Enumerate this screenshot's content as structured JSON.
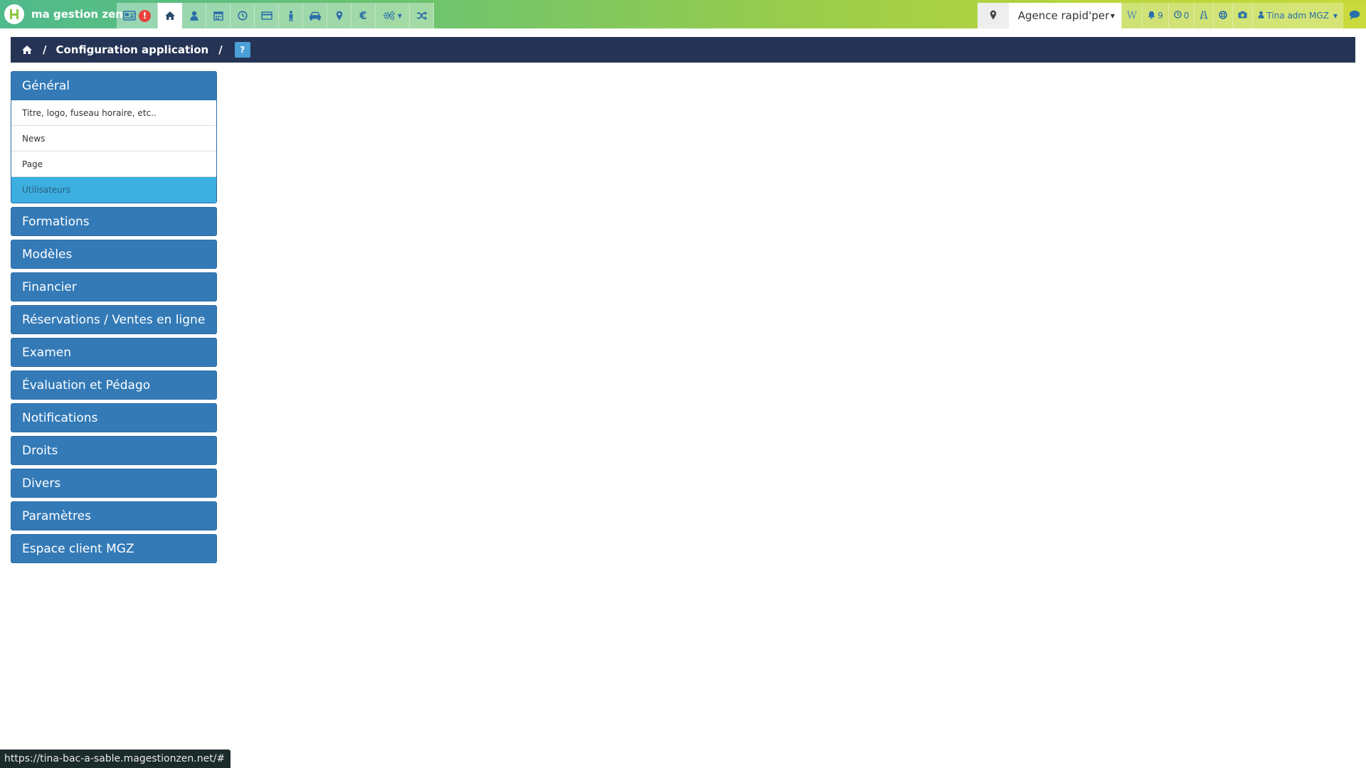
{
  "app": {
    "brand_name": "ma gestion zen"
  },
  "topnav": {
    "alert_badge": "!",
    "items": [
      "news-icon",
      "home-icon",
      "user-icon",
      "calendar-icon",
      "clock-icon",
      "credit-card-icon",
      "person-icon",
      "car-icon",
      "map-marker-icon",
      "euro-icon",
      "settings-icon",
      "shuffle-icon"
    ]
  },
  "rightnav": {
    "agency_select": "Agence rapid'permis",
    "wiki_label": "W",
    "notifications_count": "9",
    "pending_count": "0",
    "user_name": "Tina adm MGZ"
  },
  "breadcrumb": {
    "current": "Configuration application",
    "help": "?"
  },
  "sidemenu": {
    "groups": [
      {
        "label": "Général",
        "items": [
          "Titre, logo, fuseau horaire, etc..",
          "News",
          "Page",
          "Utilisateurs"
        ]
      },
      {
        "label": "Formations"
      },
      {
        "label": "Modèles"
      },
      {
        "label": "Financier"
      },
      {
        "label": "Réservations / Ventes en ligne"
      },
      {
        "label": "Examen"
      },
      {
        "label": "Évaluation et Pédago"
      },
      {
        "label": "Notifications"
      },
      {
        "label": "Droits"
      },
      {
        "label": "Divers"
      },
      {
        "label": "Paramètres"
      },
      {
        "label": "Espace client MGZ"
      }
    ],
    "active_item": "Utilisateurs"
  },
  "statusbar": {
    "url": "https://tina-bac-a-sable.magestionzen.net/#"
  },
  "colors": {
    "primary": "#337ab7",
    "breadcrumb_bg": "#253455",
    "active_sub": "#3caee0",
    "alert": "#e8423c"
  }
}
